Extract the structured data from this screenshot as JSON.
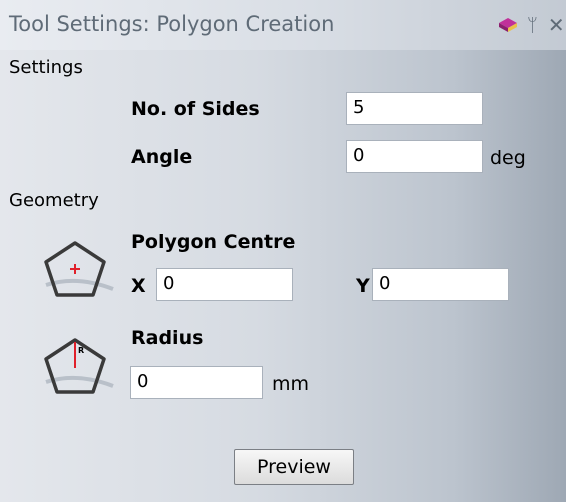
{
  "window": {
    "title": "Tool Settings: Polygon Creation",
    "icons": [
      "book-icon",
      "pin-icon",
      "close-icon"
    ]
  },
  "settings": {
    "section_label": "Settings",
    "sides": {
      "label": "No. of Sides",
      "value": "5"
    },
    "angle": {
      "label": "Angle",
      "value": "0",
      "unit": "deg"
    }
  },
  "geometry": {
    "section_label": "Geometry",
    "centre": {
      "label": "Polygon Centre",
      "x_label": "X",
      "x_value": "0",
      "y_label": "Y",
      "y_value": "0",
      "icon": "polygon-centre-icon"
    },
    "radius": {
      "label": "Radius",
      "value": "0",
      "unit": "mm",
      "icon": "polygon-radius-icon"
    }
  },
  "actions": {
    "preview_label": "Preview"
  },
  "colors": {
    "accent_red": "#e0202a",
    "icon_pink": "#c0319a"
  }
}
